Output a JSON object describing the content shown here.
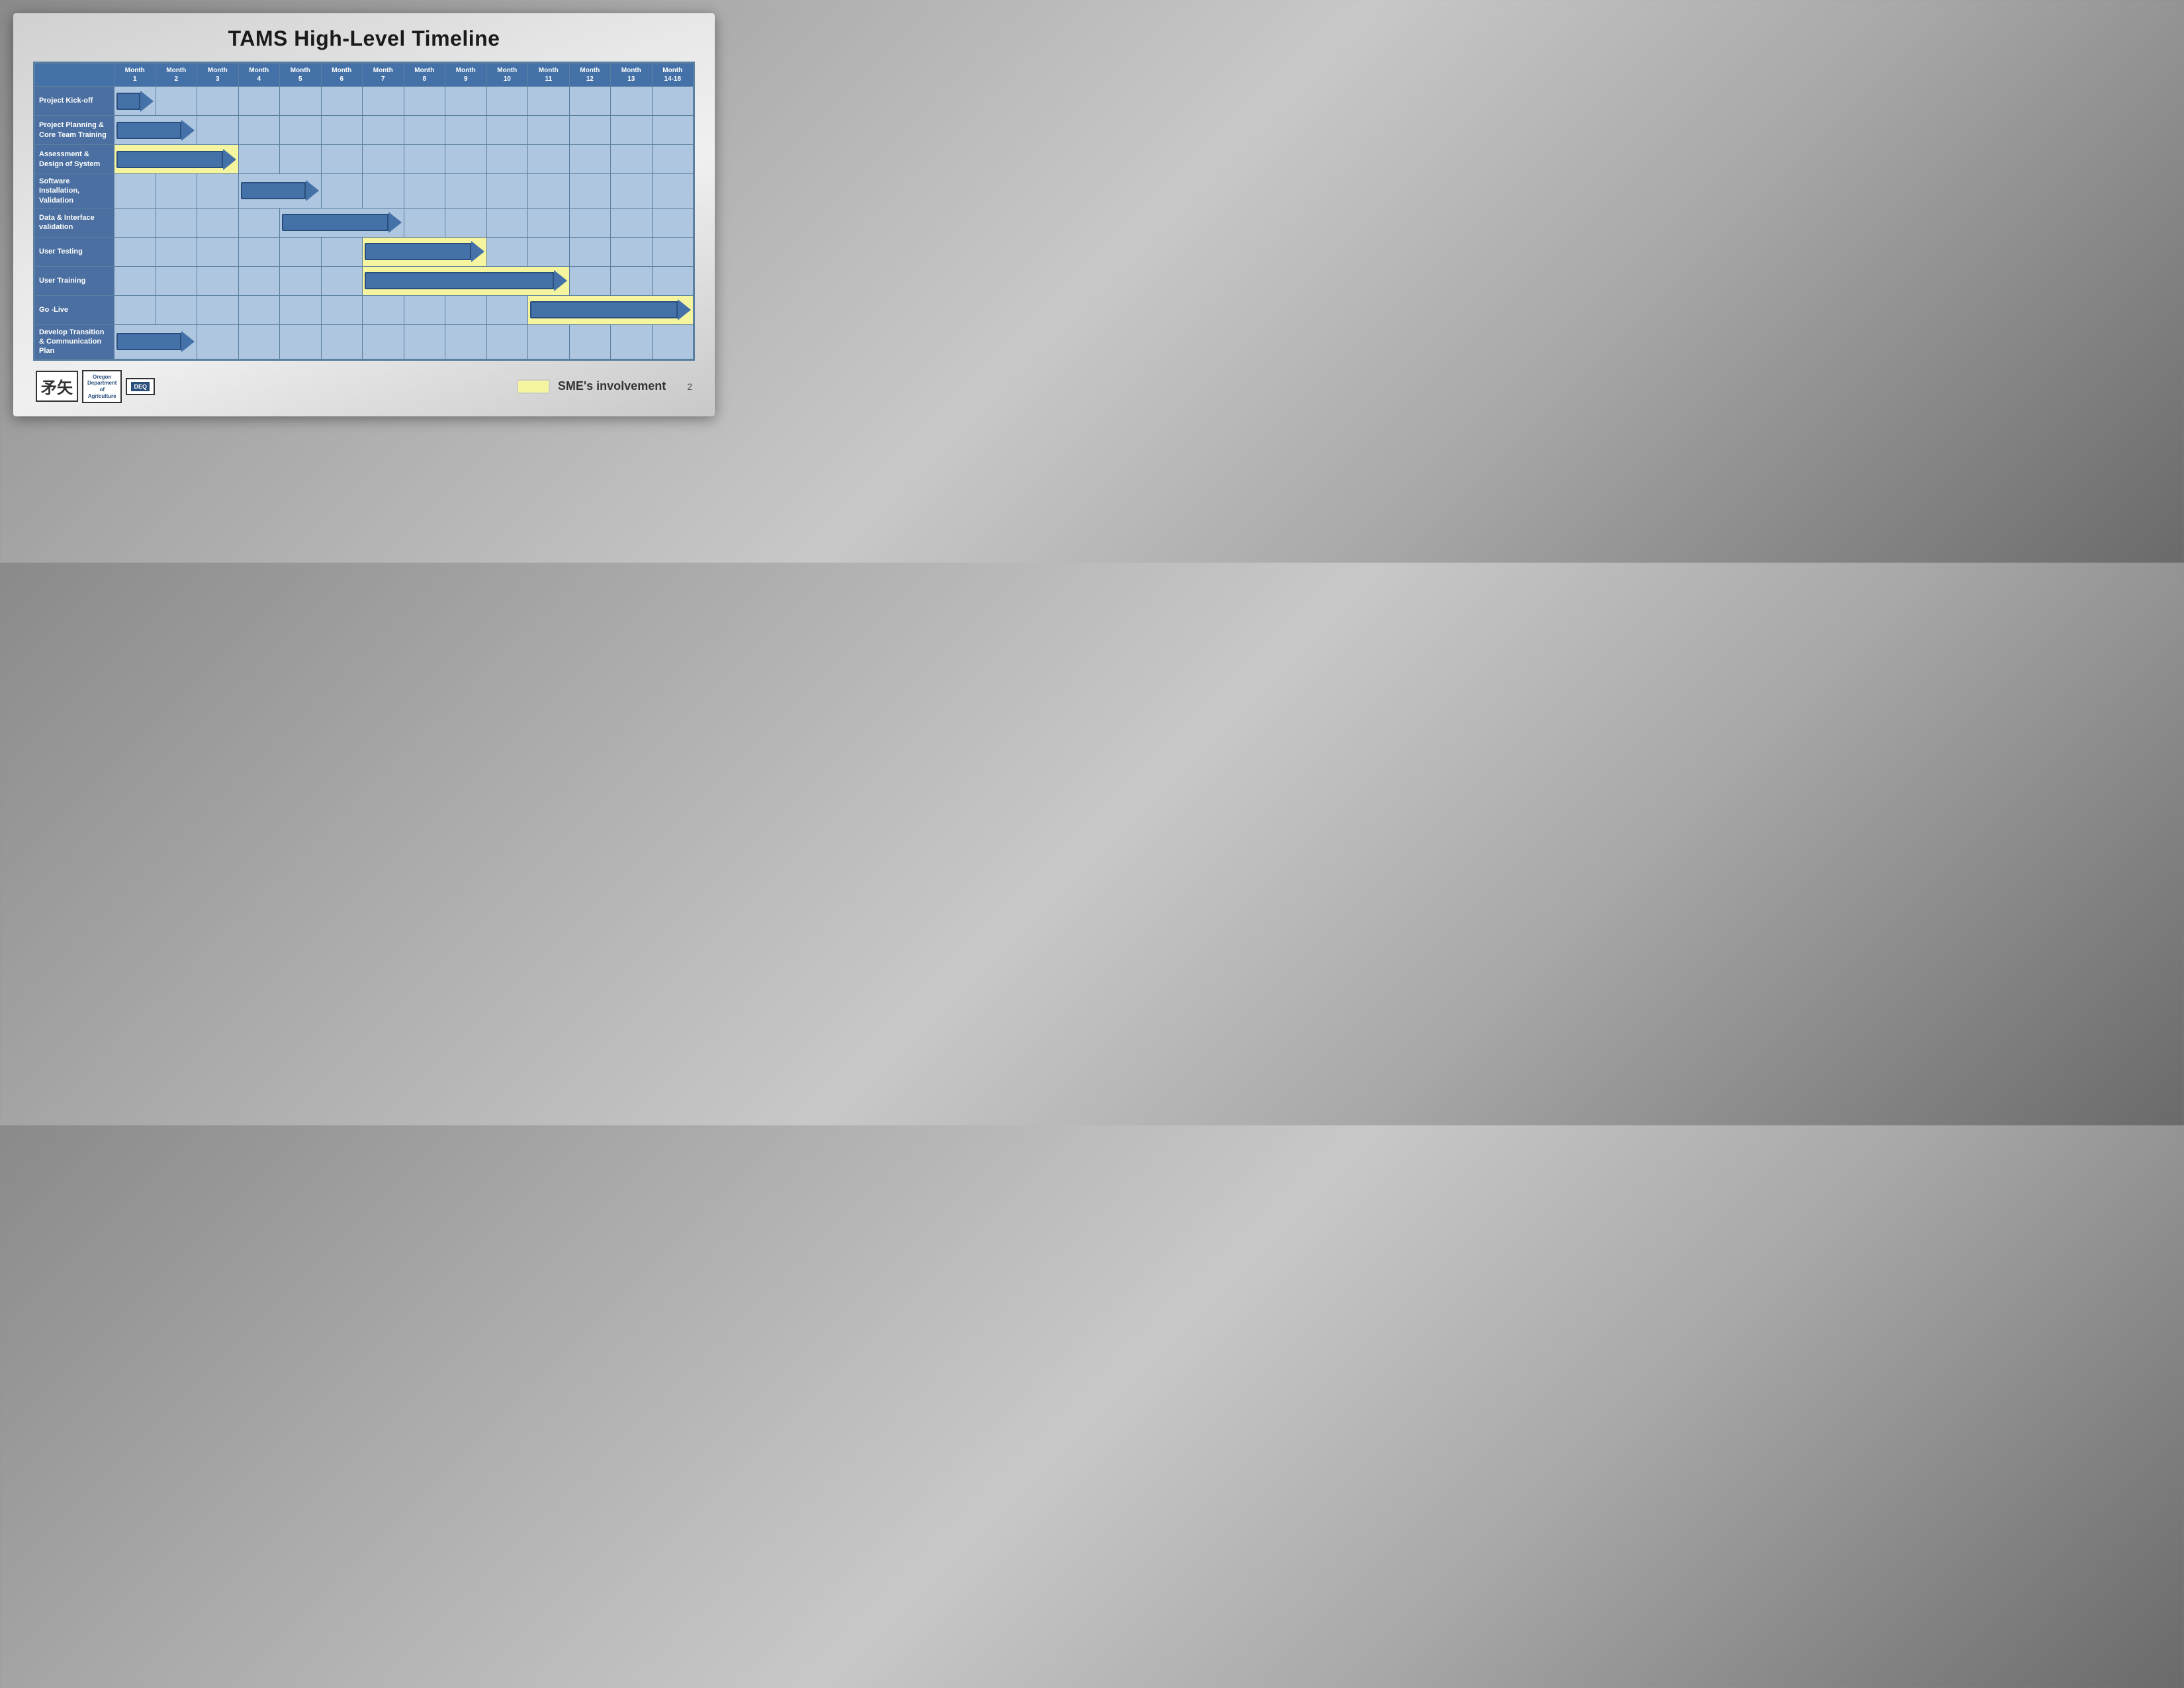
{
  "title": "TAMS High-Level Timeline",
  "months": [
    {
      "label": "Month",
      "sub": "1"
    },
    {
      "label": "Month",
      "sub": "2"
    },
    {
      "label": "Month",
      "sub": "3"
    },
    {
      "label": "Month",
      "sub": "4"
    },
    {
      "label": "Month",
      "sub": "5"
    },
    {
      "label": "Month",
      "sub": "6"
    },
    {
      "label": "Month",
      "sub": "7"
    },
    {
      "label": "Month",
      "sub": "8"
    },
    {
      "label": "Month",
      "sub": "9"
    },
    {
      "label": "Month",
      "sub": "10"
    },
    {
      "label": "Month",
      "sub": "11"
    },
    {
      "label": "Month",
      "sub": "12"
    },
    {
      "label": "Month",
      "sub": "13"
    },
    {
      "label": "Month",
      "sub": "14-18"
    }
  ],
  "rows": [
    {
      "label": "Project Kick-off",
      "arrow_start": 0,
      "arrow_cols": 1,
      "yellow": false
    },
    {
      "label": "Project Planning & Core Team Training",
      "arrow_start": 0,
      "arrow_cols": 2,
      "yellow": false
    },
    {
      "label": "Assessment & Design of System",
      "arrow_start": 0,
      "arrow_cols": 3,
      "yellow": true
    },
    {
      "label": "Software Installation, Validation",
      "arrow_start": 3,
      "arrow_cols": 2,
      "yellow": false
    },
    {
      "label": "Data & Interface validation",
      "arrow_start": 4,
      "arrow_cols": 3,
      "yellow": false
    },
    {
      "label": "User Testing",
      "arrow_start": 6,
      "arrow_cols": 3,
      "yellow": true
    },
    {
      "label": "User Training",
      "arrow_start": 6,
      "arrow_cols": 5,
      "yellow": true
    },
    {
      "label": "Go -Live",
      "arrow_start": 10,
      "arrow_cols": 4,
      "yellow": true
    },
    {
      "label": "Develop Transition & Communication Plan",
      "arrow_start": 0,
      "arrow_cols": 2,
      "yellow": false
    }
  ],
  "legend": {
    "box_color": "#f5f5a0",
    "text": "SME's involvement"
  },
  "page_number": "2"
}
